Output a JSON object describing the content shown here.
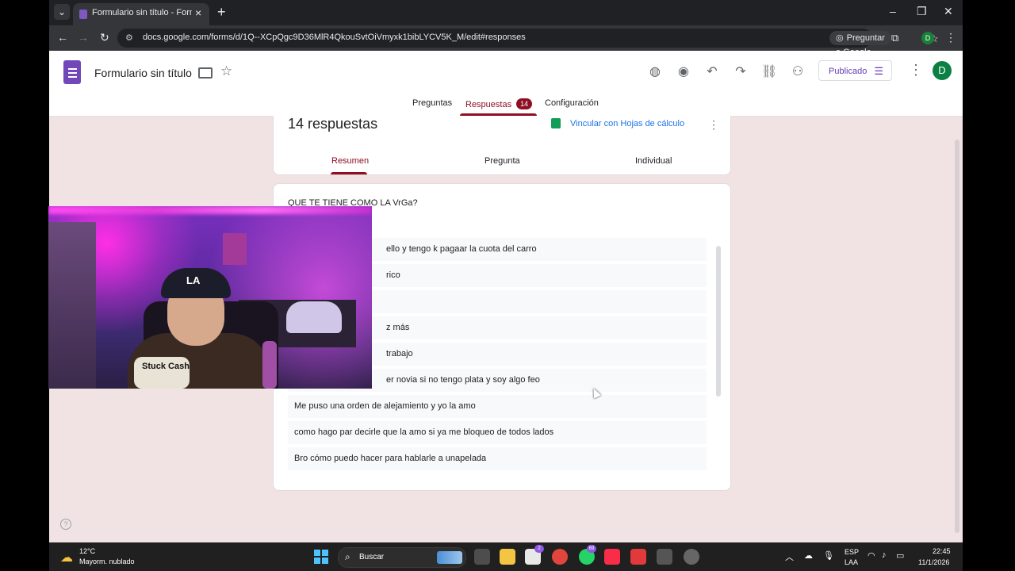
{
  "browser": {
    "tab_title": "Formulario sin título - Formular",
    "url": "docs.google.com/forms/d/1Q--XCpQgc9D36MlR4QkouSvtOiVmyxk1bibLYCV5K_M/edit#responses",
    "ask_google": "Preguntar a Google",
    "profile_initial": "D"
  },
  "form": {
    "title": "Formulario sin título",
    "publish_label": "Publicado",
    "avatar_initial": "D",
    "tabs": [
      {
        "label": "Preguntas"
      },
      {
        "label": "Respuestas",
        "badge": "14"
      },
      {
        "label": "Configuración"
      }
    ]
  },
  "responses": {
    "count_label": "14 respuestas",
    "sheets_link": "Vincular con Hojas de cálculo",
    "subtabs": [
      "Resumen",
      "Pregunta",
      "Individual"
    ],
    "question": "QUE TE TIENE COMO LA VrGa?",
    "answers": [
      "ello y tengo k pagaar la cuota del carro",
      "rico",
      "",
      "z más",
      "trabajo",
      "er novia si no tengo plata y soy algo feo",
      "Me puso una orden de alejamiento y yo la amo",
      "como hago par decirle que la amo si ya me bloqueo de todos lados",
      "Bro cómo puedo hacer para hablarle a unapelada"
    ]
  },
  "webcam": {
    "cap_text": "LA",
    "jacket_text": "Stuck Cash"
  },
  "taskbar": {
    "temp": "12°C",
    "weather": "Mayorm. nublado",
    "search_label": "Buscar",
    "teams_badge": "2",
    "whatsapp_badge": "69",
    "lang_line1": "ESP",
    "lang_line2": "LAA",
    "time": "22:45",
    "date": "11/1/2026"
  }
}
